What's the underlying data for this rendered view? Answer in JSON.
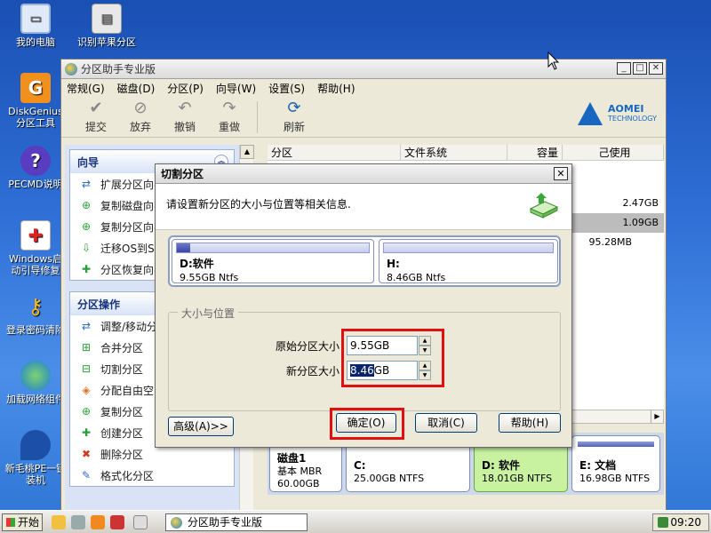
{
  "desktop": {
    "icons": [
      {
        "label": "我的电脑"
      },
      {
        "label": "识别苹果分区"
      },
      {
        "label": "DiskGenius分区工具"
      },
      {
        "label": "PECMD说明"
      },
      {
        "label": "Windows启动引导修复"
      },
      {
        "label": "登录密码清除"
      },
      {
        "label": "加载网络组件"
      },
      {
        "label": "新毛桃PE一键装机"
      }
    ]
  },
  "app": {
    "title": "分区助手专业版",
    "menu": [
      "常规(G)",
      "磁盘(D)",
      "分区(P)",
      "向导(W)",
      "设置(S)",
      "帮助(H)"
    ],
    "toolbar": [
      "提交",
      "放弃",
      "撤销",
      "重做",
      "刷新"
    ],
    "brand": {
      "name": "AOMEI",
      "sub": "TECHNOLOGY"
    }
  },
  "sidebar": {
    "wizard_title": "向导",
    "wizard_items": [
      "扩展分区向导",
      "复制磁盘向导",
      "复制分区向导",
      "迁移OS到SSD",
      "分区恢复向导"
    ],
    "ops_title": "分区操作",
    "ops_items": [
      "调整/移动分区",
      "合并分区",
      "切割分区",
      "分配自由空间",
      "复制分区",
      "创建分区",
      "删除分区",
      "格式化分区"
    ]
  },
  "table": {
    "columns": [
      "分区",
      "文件系统",
      "容量",
      "己使用"
    ],
    "used_values": [
      "2.47GB",
      "1.09GB",
      "95.28MB"
    ]
  },
  "disk_map": {
    "disk": {
      "name": "磁盘1",
      "type": "基本 MBR",
      "size": "60.00GB"
    },
    "partitions": [
      {
        "name": "C:",
        "fs": "25.00GB NTFS"
      },
      {
        "name": "D: 软件",
        "fs": "18.01GB NTFS"
      },
      {
        "name": "E: 文档",
        "fs": "16.98GB NTFS"
      }
    ]
  },
  "dialog": {
    "title": "切割分区",
    "close": "✕",
    "message": "请设置新分区的大小与位置等相关信息.",
    "part_left": {
      "name": "D:软件",
      "info": "9.55GB Ntfs"
    },
    "part_right": {
      "name": "H:",
      "info": "8.46GB Ntfs"
    },
    "group_label": "大小与位置",
    "orig_label": "原始分区大小",
    "orig_value": "9.55GB",
    "new_label": "新分区大小",
    "new_value_sel": "8.46",
    "new_value_rest": "GB",
    "advanced_btn": "高级(A)>>",
    "ok_btn": "确定(O)",
    "cancel_btn": "取消(C)",
    "help_btn": "帮助(H)"
  },
  "taskbar": {
    "start": "开始",
    "task": "分区助手专业版",
    "time": "09:20"
  }
}
